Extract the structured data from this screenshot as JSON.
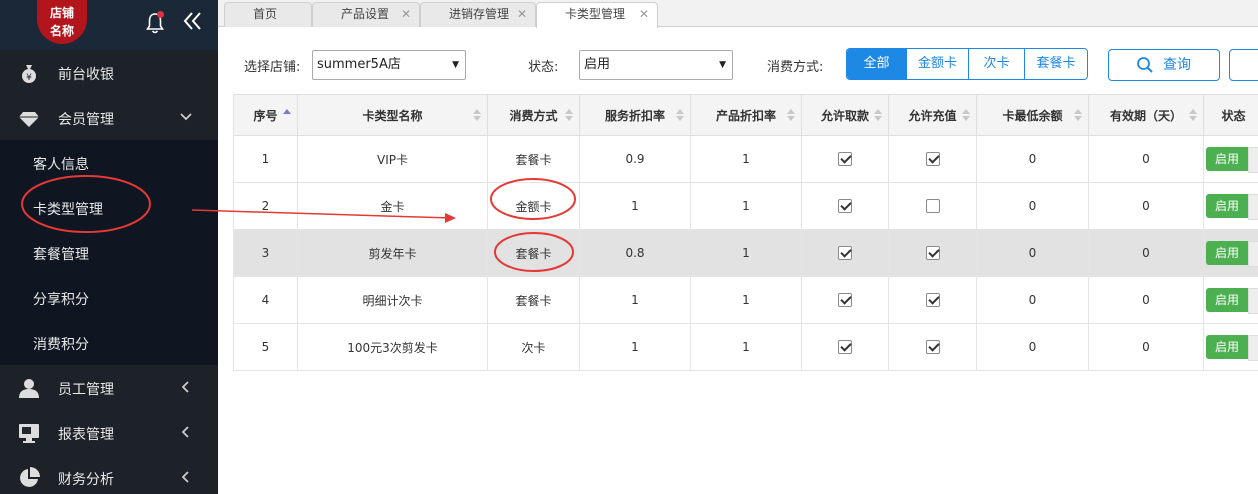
{
  "sidebar": {
    "logo_text": "店铺名称",
    "logo_line1": "店铺",
    "logo_line2": "名称",
    "menu": [
      {
        "label": "前台收银",
        "icon": "money-bag-icon"
      },
      {
        "label": "会员管理",
        "icon": "diamond-icon",
        "expanded": true
      },
      {
        "label": "员工管理",
        "icon": "user-icon"
      },
      {
        "label": "报表管理",
        "icon": "monitor-icon"
      },
      {
        "label": "财务分析",
        "icon": "pie-chart-icon"
      }
    ],
    "submenu": [
      "客人信息",
      "卡类型管理",
      "套餐管理",
      "分享积分",
      "消费积分"
    ]
  },
  "tabs": [
    {
      "label": "首页",
      "closable": false
    },
    {
      "label": "产品设置",
      "closable": true
    },
    {
      "label": "进销存管理",
      "closable": true
    },
    {
      "label": "卡类型管理",
      "closable": true,
      "active": true
    }
  ],
  "filters": {
    "store_label": "选择店铺:",
    "store_value": "summer5A店",
    "status_label": "状态:",
    "status_value": "启用",
    "consume_label": "消费方式:",
    "consume_options": [
      "全部",
      "金额卡",
      "次卡",
      "套餐卡"
    ],
    "consume_selected": "全部",
    "query_label": "查询"
  },
  "table": {
    "columns": [
      "序号",
      "卡类型名称",
      "消费方式",
      "服务折扣率",
      "产品折扣率",
      "允许取款",
      "允许充值",
      "卡最低余额",
      "有效期（天）",
      "状态"
    ],
    "rows": [
      {
        "no": "1",
        "name": "VIP卡",
        "mode": "套餐卡",
        "service": "0.9",
        "product": "1",
        "withdraw": true,
        "recharge": true,
        "min_balance": "0",
        "validity": "0",
        "status": "启用"
      },
      {
        "no": "2",
        "name": "金卡",
        "mode": "金额卡",
        "service": "1",
        "product": "1",
        "withdraw": true,
        "recharge": false,
        "min_balance": "0",
        "validity": "0",
        "status": "启用"
      },
      {
        "no": "3",
        "name": "剪发年卡",
        "mode": "套餐卡",
        "service": "0.8",
        "product": "1",
        "withdraw": true,
        "recharge": true,
        "min_balance": "0",
        "validity": "0",
        "status": "启用"
      },
      {
        "no": "4",
        "name": "明细计次卡",
        "mode": "套餐卡",
        "service": "1",
        "product": "1",
        "withdraw": true,
        "recharge": true,
        "min_balance": "0",
        "validity": "0",
        "status": "启用"
      },
      {
        "no": "5",
        "name": "100元3次剪发卡",
        "mode": "次卡",
        "service": "1",
        "product": "1",
        "withdraw": true,
        "recharge": true,
        "min_balance": "0",
        "validity": "0",
        "status": "启用"
      }
    ],
    "highlighted_row": 2
  },
  "colors": {
    "sidebar_bg": "#22282e",
    "sidebar_sub_bg": "#0f1621",
    "accent": "#1e88e5",
    "logo": "#b3151c",
    "status_green": "#4caf50",
    "annotation_red": "#e53935"
  }
}
